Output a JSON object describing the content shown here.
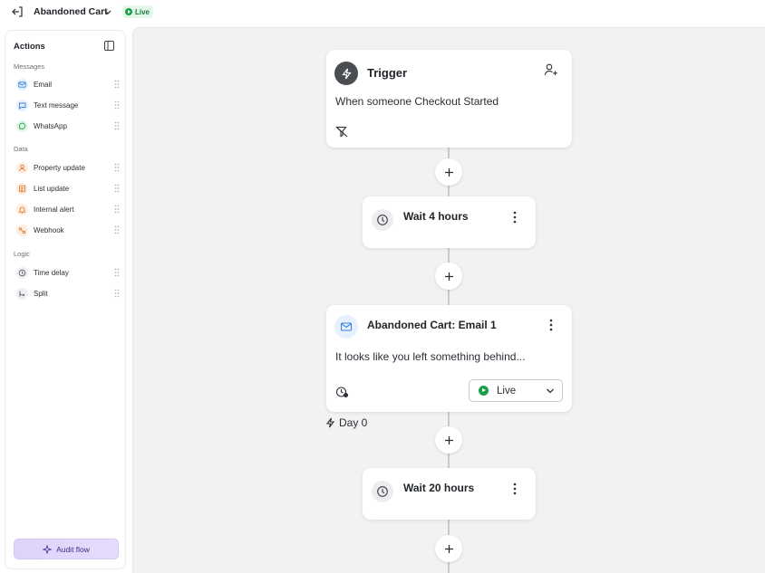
{
  "header": {
    "back_icon": "exit-icon",
    "flow_name": "Abandoned Cart",
    "status_badge": "Live"
  },
  "sidebar": {
    "title": "Actions",
    "sections": [
      {
        "label": "Messages",
        "items": [
          {
            "label": "Email",
            "icon": "mail-icon"
          },
          {
            "label": "Text message",
            "icon": "sms-icon"
          },
          {
            "label": "WhatsApp",
            "icon": "whatsapp-icon"
          }
        ]
      },
      {
        "label": "Data",
        "items": [
          {
            "label": "Property update",
            "icon": "person-icon"
          },
          {
            "label": "List update",
            "icon": "list-icon"
          },
          {
            "label": "Internal alert",
            "icon": "bell-icon"
          },
          {
            "label": "Webhook",
            "icon": "webhook-icon"
          }
        ]
      },
      {
        "label": "Logic",
        "items": [
          {
            "label": "Time delay",
            "icon": "clock-icon"
          },
          {
            "label": "Split",
            "icon": "split-icon"
          }
        ]
      }
    ],
    "audit_button": "Audit flow"
  },
  "flow": {
    "trigger": {
      "title": "Trigger",
      "description": "When someone Checkout Started"
    },
    "wait1": {
      "title": "Wait 4 hours"
    },
    "email1": {
      "title": "Abandoned Cart: Email 1",
      "preview": "It looks like you left something behind...",
      "status": "Live"
    },
    "day_label": "Day 0",
    "wait2": {
      "title": "Wait 20 hours"
    }
  },
  "colors": {
    "live_green": "#1e9e4a",
    "canvas_bg": "#f2f2f3",
    "audit_purple": "#ddd3fb"
  }
}
